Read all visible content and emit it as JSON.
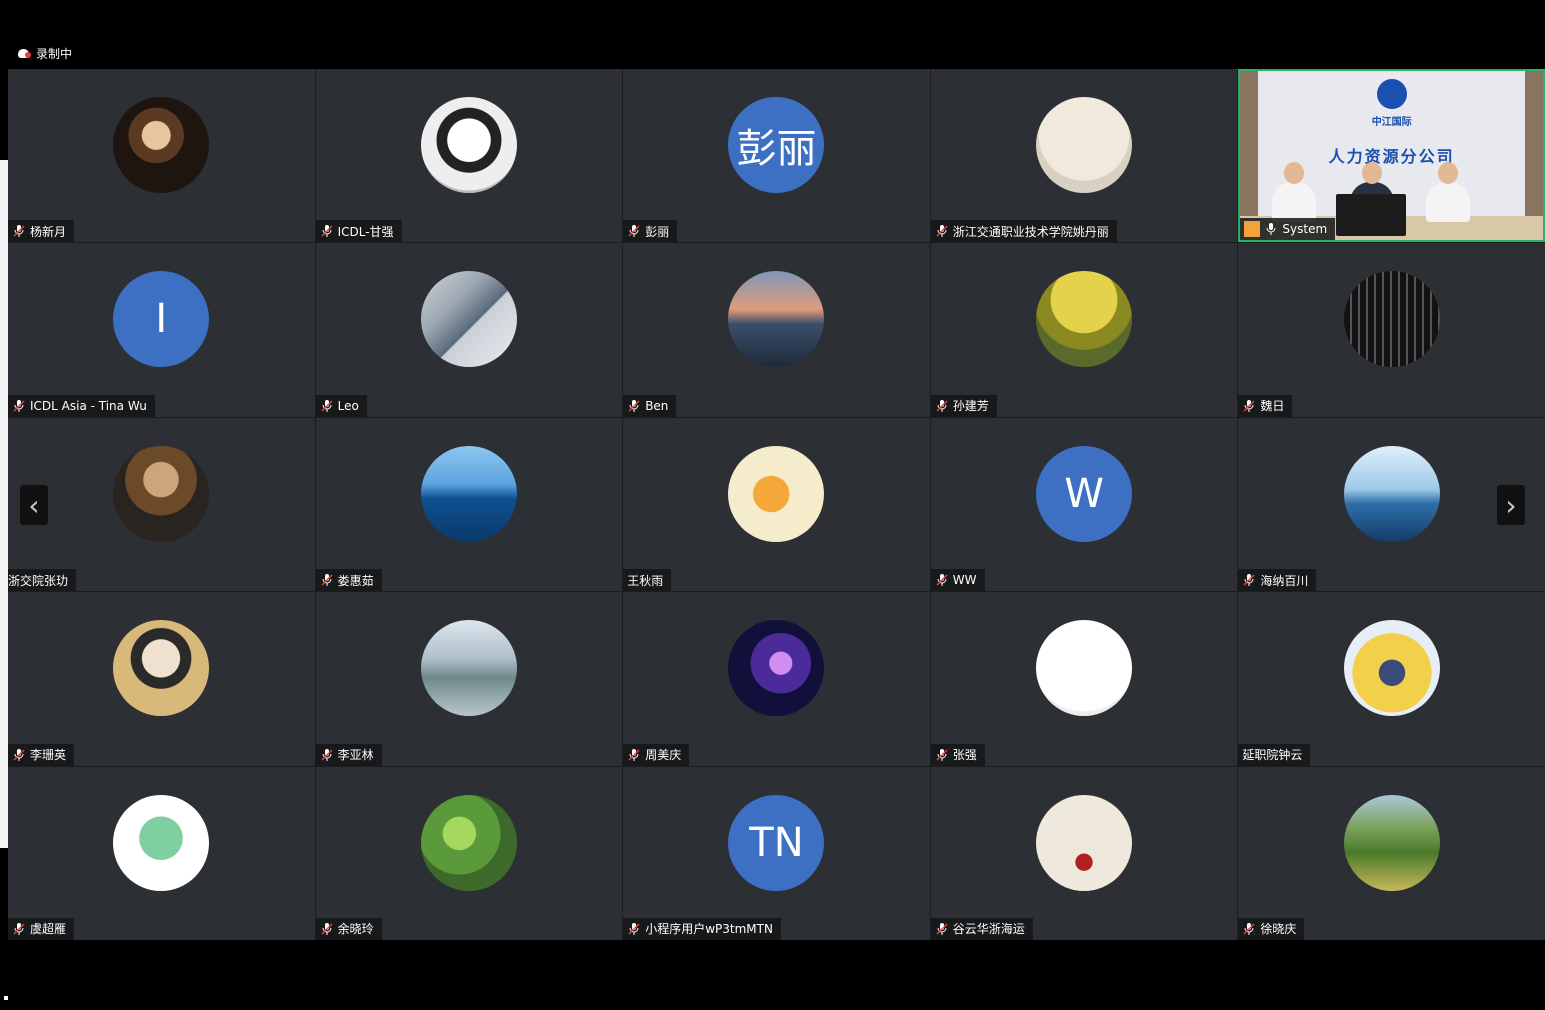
{
  "recording": {
    "label": "录制中"
  },
  "colors": {
    "tile_bg": "#2c2f33",
    "letter_avatar": "#3d6fc2",
    "active_speaker_border": "#27b36a"
  },
  "participants": [
    {
      "name": "杨新月",
      "mic": true
    },
    {
      "name": "ICDL-甘强",
      "mic": true
    },
    {
      "name": "彭丽",
      "mic": true,
      "initials": "彭丽"
    },
    {
      "name": "浙江交通职业技术学院姚丹丽",
      "mic": true
    },
    {
      "name": "System",
      "mic": true,
      "video": true,
      "video_text": {
        "brand": "中江国际",
        "title": "人力资源分公司"
      }
    },
    {
      "name": "ICDL Asia - Tina Wu",
      "mic": true,
      "initials": "I"
    },
    {
      "name": "Leo",
      "mic": true
    },
    {
      "name": "Ben",
      "mic": true
    },
    {
      "name": "孙建芳",
      "mic": true
    },
    {
      "name": "魏日",
      "mic": true
    },
    {
      "name": "浙交院张玏",
      "mic": false
    },
    {
      "name": "娄惠茹",
      "mic": true
    },
    {
      "name": "王秋雨",
      "mic": false
    },
    {
      "name": "WW",
      "mic": true,
      "initials": "W"
    },
    {
      "name": "海纳百川",
      "mic": true
    },
    {
      "name": "李珊英",
      "mic": true
    },
    {
      "name": "李亚林",
      "mic": true
    },
    {
      "name": "周美庆",
      "mic": true
    },
    {
      "name": "张强",
      "mic": true
    },
    {
      "name": "延职院钟云",
      "mic": false
    },
    {
      "name": "虞超雁",
      "mic": true
    },
    {
      "name": "余晓玲",
      "mic": true
    },
    {
      "name": "小程序用户wP3tmMTN",
      "mic": true,
      "initials": "TN"
    },
    {
      "name": "谷云华浙海运",
      "mic": true
    },
    {
      "name": "徐晓庆",
      "mic": true
    }
  ],
  "nav": {
    "prev_icon": "chevron-left-icon",
    "next_icon": "chevron-right-icon",
    "prev_glyph": "‹",
    "next_glyph": "›"
  }
}
